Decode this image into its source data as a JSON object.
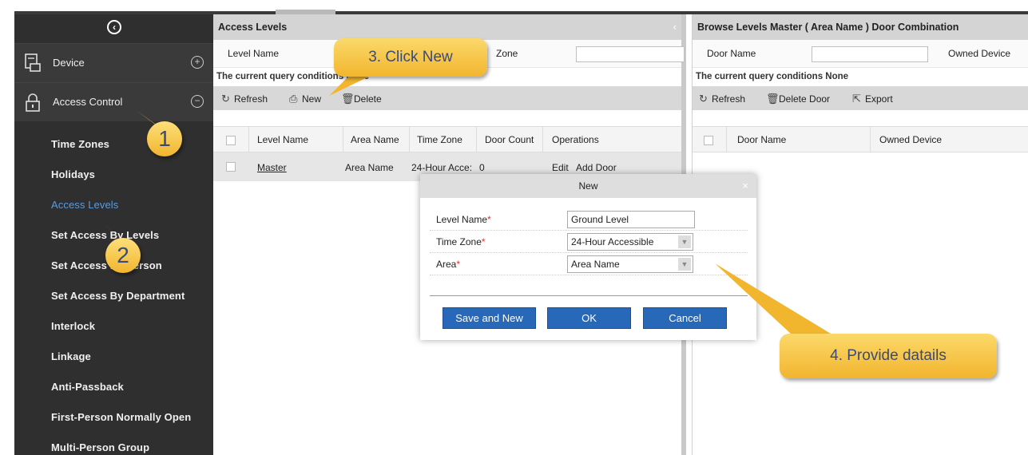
{
  "sidebar": {
    "sections": [
      {
        "label": "Device",
        "icon": "device-icon",
        "toggle": "+"
      },
      {
        "label": "Access Control",
        "icon": "lock-icon",
        "toggle": "−"
      }
    ],
    "items": [
      {
        "label": "Time Zones"
      },
      {
        "label": "Holidays"
      },
      {
        "label": "Access Levels"
      },
      {
        "label": "Set Access By Levels"
      },
      {
        "label": "Set Access By Person"
      },
      {
        "label": "Set Access By Department"
      },
      {
        "label": "Interlock"
      },
      {
        "label": "Linkage"
      },
      {
        "label": "Anti-Passback"
      },
      {
        "label": "First-Person Normally Open"
      },
      {
        "label": "Multi-Person Group"
      }
    ],
    "active_item": "Access Levels"
  },
  "left_panel": {
    "title": "Access Levels",
    "query": {
      "level_name_label": "Level Name",
      "time_zone_label": "Zone"
    },
    "conditions": "The current query conditions None",
    "toolbar": {
      "refresh": "Refresh",
      "new": "New",
      "delete": "Delete"
    },
    "columns": [
      "Level Name",
      "Area Name",
      "Time Zone",
      "Door Count",
      "Operations"
    ],
    "rows": [
      {
        "level_name": "Master",
        "area_name": "Area Name",
        "time_zone": "24-Hour Acce:",
        "door_count": "0",
        "ops_edit": "Edit",
        "ops_add_door": "Add Door"
      }
    ]
  },
  "right_panel": {
    "title": "Browse Levels Master ( Area Name ) Door Combination",
    "query": {
      "door_name_label": "Door Name",
      "owned_device_label": "Owned Device"
    },
    "conditions": "The current query conditions None",
    "toolbar": {
      "refresh": "Refresh",
      "delete_door": "Delete Door",
      "export": "Export"
    },
    "columns": [
      "Door Name",
      "Owned Device"
    ]
  },
  "dialog": {
    "title": "New",
    "close": "×",
    "fields": {
      "level_name_label": "Level Name",
      "level_name_value": "Ground Level",
      "time_zone_label": "Time Zone",
      "time_zone_value": "24-Hour Accessible",
      "area_label": "Area",
      "area_value": "Area Name",
      "required_mark": "*"
    },
    "buttons": {
      "save_and_new": "Save and New",
      "ok": "OK",
      "cancel": "Cancel"
    }
  },
  "annotations": {
    "step1": "1",
    "step2": "2",
    "step3": "3. Click New",
    "step4": "4. Provide datails"
  },
  "colors": {
    "sidebar_bg": "#2f2f2f",
    "active_link": "#5b9be0",
    "button_blue": "#2868b8",
    "callout": "#f2b52e"
  }
}
